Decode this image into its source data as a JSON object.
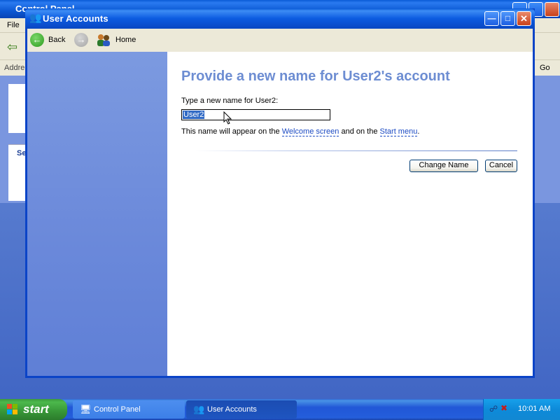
{
  "background_window": {
    "title": "Control Panel",
    "menu_file": "File",
    "address_label": "Addre",
    "go_label": "Go",
    "side_label": "Se"
  },
  "window": {
    "title": "User Accounts",
    "controls": {
      "minimize": "minimize-icon",
      "maximize": "maximize-icon",
      "close": "close-icon"
    }
  },
  "toolbar": {
    "back_label": "Back",
    "home_label": "Home"
  },
  "main": {
    "title": "Provide a new name for User2's account",
    "prompt": "Type a new name for User2:",
    "name_value": "User2",
    "info_prefix": "This name will appear on the ",
    "welcome_link": "Welcome screen",
    "info_middle": " and on the ",
    "start_link": "Start menu",
    "info_suffix": ".",
    "change_name_button": "Change Name",
    "cancel_button": "Cancel"
  },
  "taskbar": {
    "start_label": "start",
    "tasks": [
      {
        "label": "Control Panel",
        "icon": "control-panel-icon"
      },
      {
        "label": "User Accounts",
        "icon": "user-accounts-icon"
      }
    ],
    "clock": "10:01 AM"
  },
  "colors": {
    "title_blue": "#6d8dd2",
    "link_blue": "#1b4ac3",
    "sidebar": "#6d8bdb"
  }
}
